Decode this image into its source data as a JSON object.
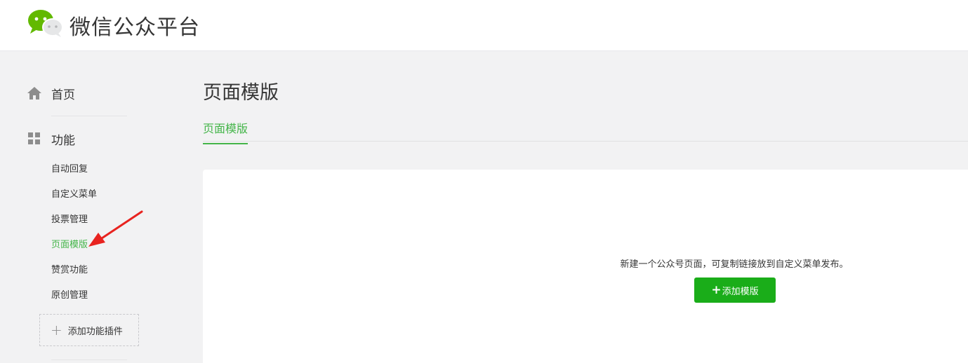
{
  "header": {
    "brand": "微信公众平台"
  },
  "sidebar": {
    "home_label": "首页",
    "features_label": "功能",
    "items": [
      {
        "label": "自动回复"
      },
      {
        "label": "自定义菜单"
      },
      {
        "label": "投票管理"
      },
      {
        "label": "页面模版"
      },
      {
        "label": "赞赏功能"
      },
      {
        "label": "原创管理"
      }
    ],
    "active_item": "页面模版",
    "add_plugin_label": "添加功能插件"
  },
  "main": {
    "title": "页面模版",
    "tabs": [
      {
        "label": "页面模版"
      }
    ],
    "hint": "新建一个公众号页面，可复制链接放到自定义菜单发布。",
    "add_button_label": "添加模版"
  },
  "colors": {
    "accent": "#44b549",
    "button": "#1aad19",
    "annotation_arrow": "#e8231f"
  }
}
